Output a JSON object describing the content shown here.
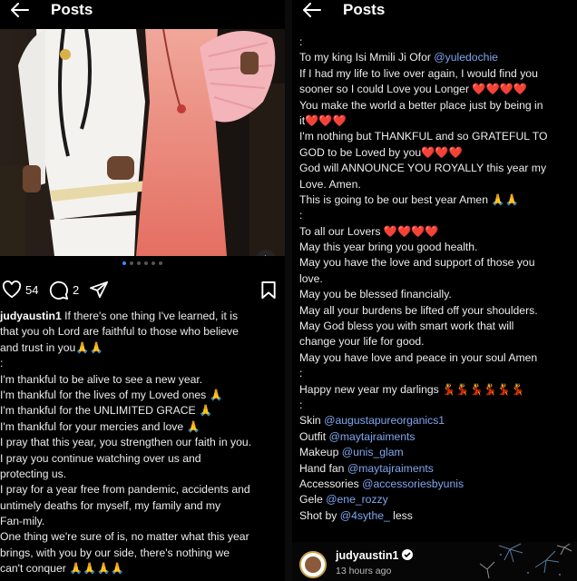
{
  "left": {
    "header": {
      "title": "Posts"
    },
    "post": {
      "likes": "54",
      "comments": "2",
      "carousel": {
        "count": 6,
        "active": 0
      },
      "caption": [
        [
          {
            "t": "judyaustin1",
            "c": "user"
          },
          {
            "t": " If there's one thing I've learned, it is"
          }
        ],
        [
          {
            "t": "that you oh Lord are faithful to those who believe"
          }
        ],
        [
          {
            "t": "and trust in you🙏🙏"
          }
        ],
        [
          {
            "t": ":"
          }
        ],
        [
          {
            "t": "I'm thankful to be alive to see a new year."
          }
        ],
        [
          {
            "t": "I'm thankful for the lives of my Loved ones 🙏"
          }
        ],
        [
          {
            "t": "I'm thankful for the UNLIMITED GRACE 🙏"
          }
        ],
        [
          {
            "t": "I'm thankful for your mercies and love 🙏"
          }
        ],
        [
          {
            "t": "I pray that this year, you strengthen our faith in you."
          }
        ],
        [
          {
            "t": "I pray you continue watching over us and"
          }
        ],
        [
          {
            "t": "protecting us."
          }
        ],
        [
          {
            "t": "I pray for a year free from pandemic, accidents and"
          }
        ],
        [
          {
            "t": "untimely deaths for myself, my family and my"
          }
        ],
        [
          {
            "t": "Fan-mily."
          }
        ],
        [
          {
            "t": "One thing we're sure of is, no matter what this year"
          }
        ],
        [
          {
            "t": "brings, with you by our side, there's nothing we"
          }
        ],
        [
          {
            "t": "can't conquer 🙏🙏🙏🙏"
          }
        ]
      ]
    }
  },
  "right": {
    "header": {
      "title": "Posts"
    },
    "caption": [
      [
        {
          "t": ":"
        }
      ],
      [
        {
          "t": "To my king Isi Mmili Ji Ofor "
        },
        {
          "t": "@yuledochie",
          "c": "link"
        }
      ],
      [
        {
          "t": "If I had my life to live over again, I would find you"
        }
      ],
      [
        {
          "t": "sooner so I could Love you Longer ❤️❤️❤️❤️"
        }
      ],
      [
        {
          "t": "You make the world a better place just by being in"
        }
      ],
      [
        {
          "t": "it❤️❤️❤️"
        }
      ],
      [
        {
          "t": "I'm nothing but THANKFUL and so GRATEFUL TO"
        }
      ],
      [
        {
          "t": "GOD to be Loved by you❤️❤️❤️"
        }
      ],
      [
        {
          "t": "God will ANNOUNCE YOU ROYALLY this year my"
        }
      ],
      [
        {
          "t": "Love.  Amen."
        }
      ],
      [
        {
          "t": "This is going to be our best year Amen 🙏🙏"
        }
      ],
      [
        {
          "t": ":"
        }
      ],
      [
        {
          "t": "To all our Lovers ❤️❤️❤️❤️"
        }
      ],
      [
        {
          "t": "May this year bring you good health."
        }
      ],
      [
        {
          "t": "May you have the love and support of those you"
        }
      ],
      [
        {
          "t": "love."
        }
      ],
      [
        {
          "t": "May you be blessed financially."
        }
      ],
      [
        {
          "t": "May all your burdens be lifted off your shoulders."
        }
      ],
      [
        {
          "t": "May God bless you with smart work that will"
        }
      ],
      [
        {
          "t": "change your life for good."
        }
      ],
      [
        {
          "t": "May you have love and peace in your soul Amen"
        }
      ],
      [
        {
          "t": ":"
        }
      ],
      [
        {
          "t": "Happy new year my darlings 💃💃💃💃💃💃"
        }
      ],
      [
        {
          "t": ":"
        }
      ],
      [
        {
          "t": "Skin "
        },
        {
          "t": "@augustapureorganics1",
          "c": "link"
        }
      ],
      [
        {
          "t": "Outfit "
        },
        {
          "t": "@maytajraiments",
          "c": "link"
        }
      ],
      [
        {
          "t": "Makeup "
        },
        {
          "t": "@unis_glam",
          "c": "link"
        }
      ],
      [
        {
          "t": "Hand fan "
        },
        {
          "t": "@maytajraiments",
          "c": "link"
        }
      ],
      [
        {
          "t": "Accessories "
        },
        {
          "t": "@accessoriesbyunis",
          "c": "link"
        }
      ],
      [
        {
          "t": "Gele "
        },
        {
          "t": "@ene_rozzy",
          "c": "link"
        }
      ],
      [
        {
          "t": "Shot by "
        },
        {
          "t": "@4sythe_",
          "c": "link"
        },
        {
          "t": " less"
        }
      ]
    ],
    "next_post": {
      "username": "judyaustin1",
      "time": "13 hours ago"
    }
  }
}
